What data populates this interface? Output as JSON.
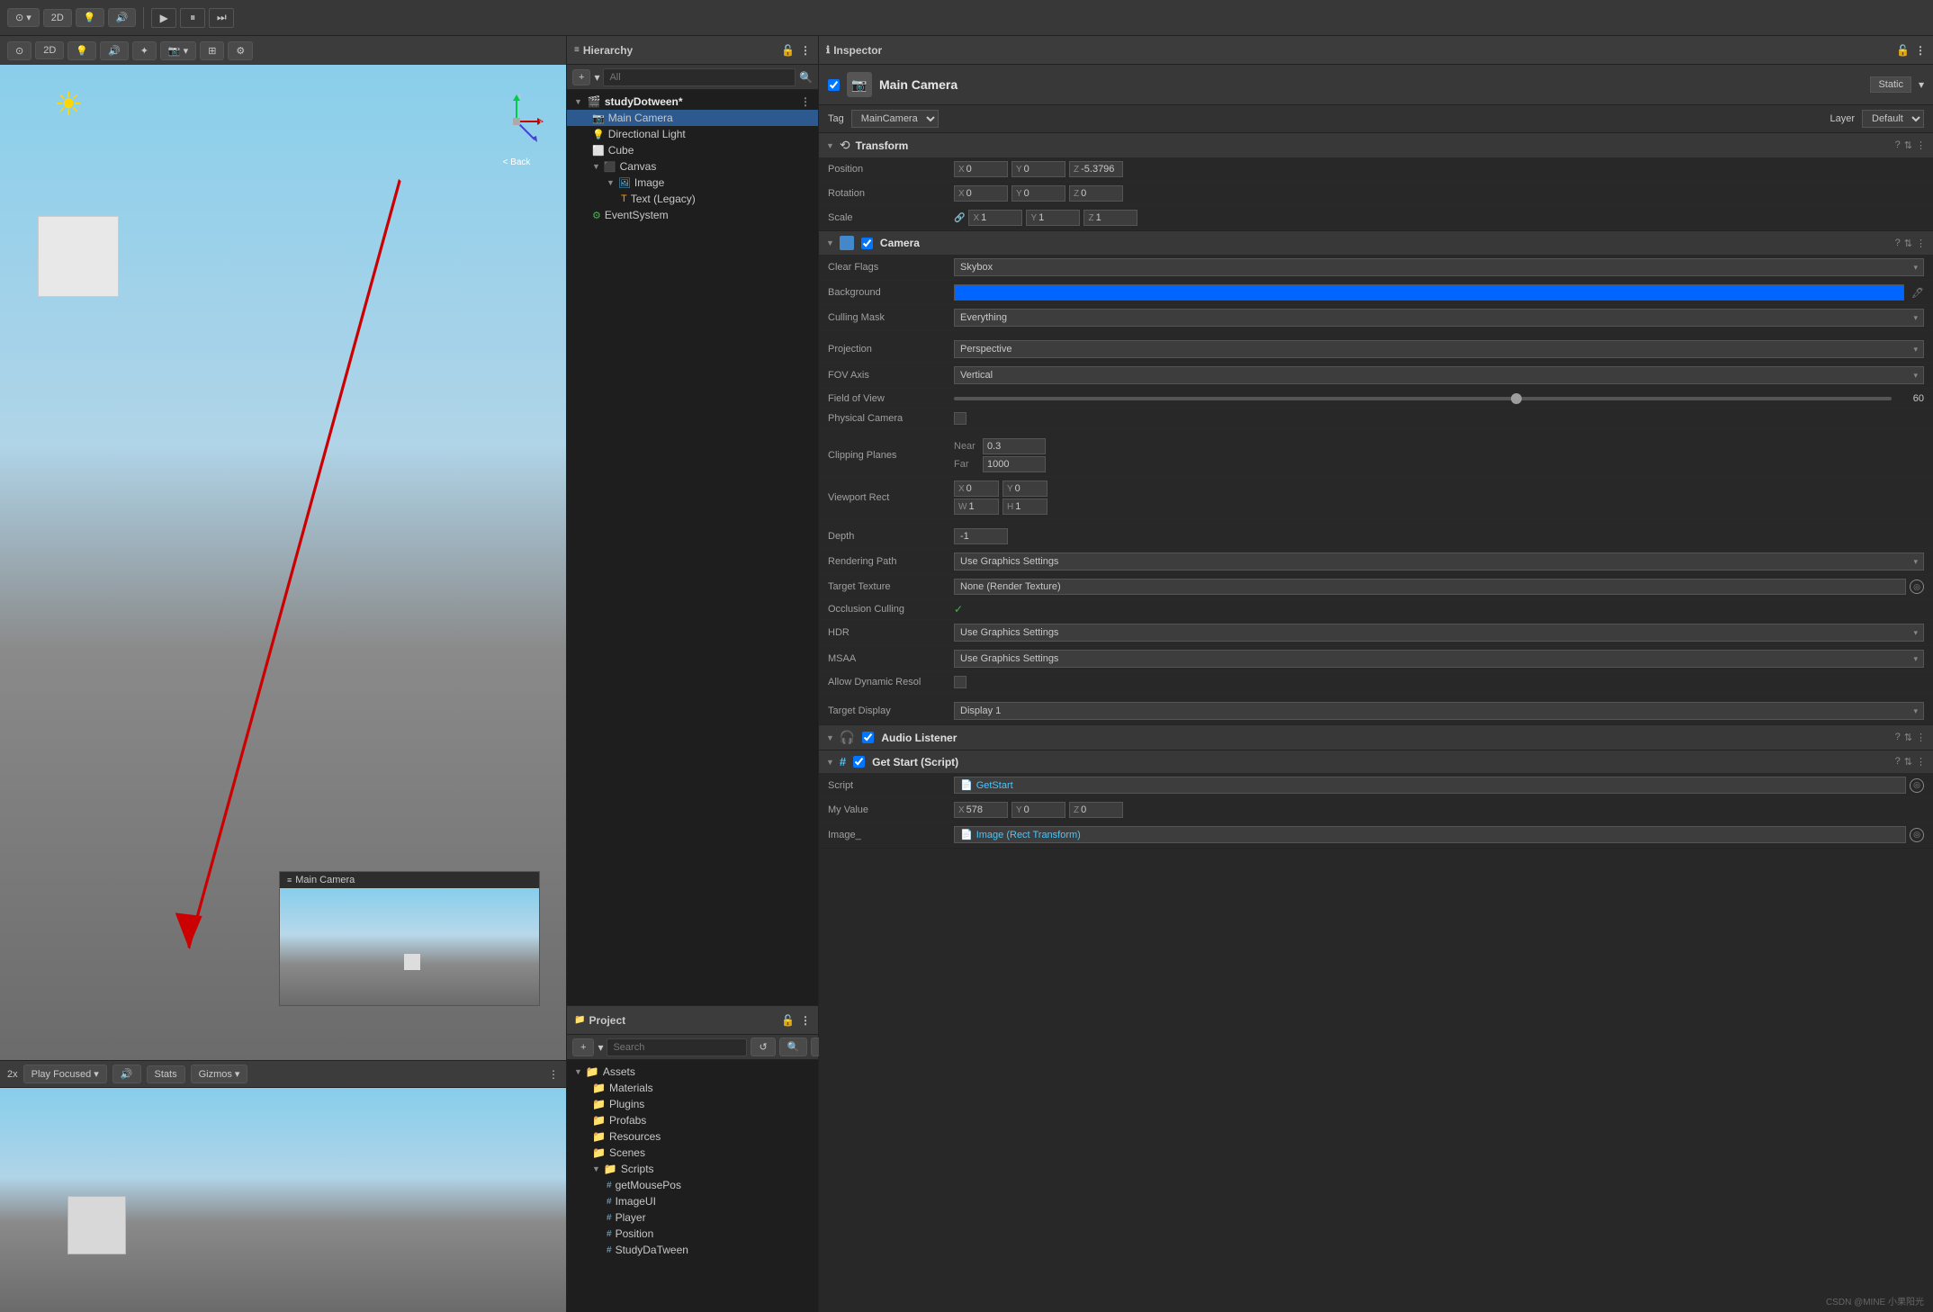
{
  "toolbar": {
    "mode_2d": "2D",
    "play": "▶",
    "pause": "⏸",
    "step": "⏭"
  },
  "hierarchy": {
    "title": "Hierarchy",
    "search_placeholder": "All",
    "items": [
      {
        "id": "studydotween",
        "label": "studyDotween*",
        "indent": 0,
        "type": "root",
        "icon": "▼"
      },
      {
        "id": "maincamera",
        "label": "Main Camera",
        "indent": 1,
        "type": "camera",
        "selected": true
      },
      {
        "id": "directionallight",
        "label": "Directional Light",
        "indent": 1,
        "type": "light"
      },
      {
        "id": "cube",
        "label": "Cube",
        "indent": 1,
        "type": "cube"
      },
      {
        "id": "canvas",
        "label": "Canvas",
        "indent": 1,
        "type": "canvas",
        "icon": "▼"
      },
      {
        "id": "image",
        "label": "Image",
        "indent": 2,
        "type": "cube",
        "icon": "▼"
      },
      {
        "id": "textlegacy",
        "label": "Text (Legacy)",
        "indent": 3,
        "type": "text"
      },
      {
        "id": "eventsystem",
        "label": "EventSystem",
        "indent": 1,
        "type": "event"
      }
    ]
  },
  "scene": {
    "back_label": "< Back",
    "camera_preview_title": "Main Camera"
  },
  "game": {
    "speed": "2x",
    "play_focused": "Play Focused",
    "stats": "Stats",
    "gizmos": "Gizmos"
  },
  "project": {
    "title": "Project",
    "items": [
      {
        "id": "assets",
        "label": "Assets",
        "type": "folder",
        "indent": 0,
        "icon": "▼"
      },
      {
        "id": "materials",
        "label": "Materials",
        "type": "folder",
        "indent": 1
      },
      {
        "id": "plugins",
        "label": "Plugins",
        "type": "folder",
        "indent": 1
      },
      {
        "id": "prefabs",
        "label": "Profabs",
        "type": "folder",
        "indent": 1
      },
      {
        "id": "resources",
        "label": "Resources",
        "type": "folder",
        "indent": 1
      },
      {
        "id": "scenes",
        "label": "Scenes",
        "type": "folder",
        "indent": 1
      },
      {
        "id": "scripts",
        "label": "Scripts",
        "type": "folder",
        "indent": 1,
        "icon": "▼"
      },
      {
        "id": "getmousepos",
        "label": "getMousePos",
        "type": "script",
        "indent": 2
      },
      {
        "id": "imageui",
        "label": "ImageUI",
        "type": "script",
        "indent": 2
      },
      {
        "id": "player",
        "label": "Player",
        "type": "script",
        "indent": 2
      },
      {
        "id": "position",
        "label": "Position",
        "type": "script",
        "indent": 2
      },
      {
        "id": "studydotween2",
        "label": "StudyDaTween",
        "type": "script",
        "indent": 2
      }
    ]
  },
  "inspector": {
    "title": "Inspector",
    "object_name": "Main Camera",
    "static_label": "Static",
    "tag_label": "Tag",
    "tag_value": "MainCamera",
    "layer_label": "Layer",
    "layer_value": "Default",
    "components": {
      "transform": {
        "name": "Transform",
        "position": {
          "x": "0",
          "y": "0",
          "z": "-5.3796"
        },
        "rotation": {
          "x": "0",
          "y": "0",
          "z": "0"
        },
        "scale": {
          "x": "1",
          "y": "1",
          "z": "1"
        }
      },
      "camera": {
        "name": "Camera",
        "clear_flags_label": "Clear Flags",
        "clear_flags_value": "Skybox",
        "background_label": "Background",
        "culling_mask_label": "Culling Mask",
        "culling_mask_value": "Everything",
        "projection_label": "Projection",
        "projection_value": "Perspective",
        "fov_axis_label": "FOV Axis",
        "fov_axis_value": "Vertical",
        "fov_label": "Field of View",
        "fov_value": "60",
        "physical_camera_label": "Physical Camera",
        "clipping_label": "Clipping Planes",
        "near_label": "Near",
        "near_value": "0.3",
        "far_label": "Far",
        "far_value": "1000",
        "viewport_label": "Viewport Rect",
        "vp_x": "0",
        "vp_y": "0",
        "vp_w": "1",
        "vp_h": "1",
        "depth_label": "Depth",
        "depth_value": "-1",
        "rendering_path_label": "Rendering Path",
        "rendering_path_value": "Use Graphics Settings",
        "target_texture_label": "Target Texture",
        "target_texture_value": "None (Render Texture)",
        "occlusion_label": "Occlusion Culling",
        "hdr_label": "HDR",
        "hdr_value": "Use Graphics Settings",
        "msaa_label": "MSAA",
        "msaa_value": "Use Graphics Settings",
        "allow_dynamic_label": "Allow Dynamic Resol",
        "target_display_label": "Target Display",
        "target_display_value": "Display 1"
      },
      "audio_listener": {
        "name": "Audio Listener"
      },
      "get_start": {
        "name": "Get Start (Script)",
        "script_label": "Script",
        "script_value": "GetStart",
        "my_value_label": "My Value",
        "my_value_x": "578",
        "my_value_y": "0",
        "my_value_z": "0",
        "image_label": "Image_",
        "image_value": "Image (Rect Transform)"
      }
    }
  }
}
